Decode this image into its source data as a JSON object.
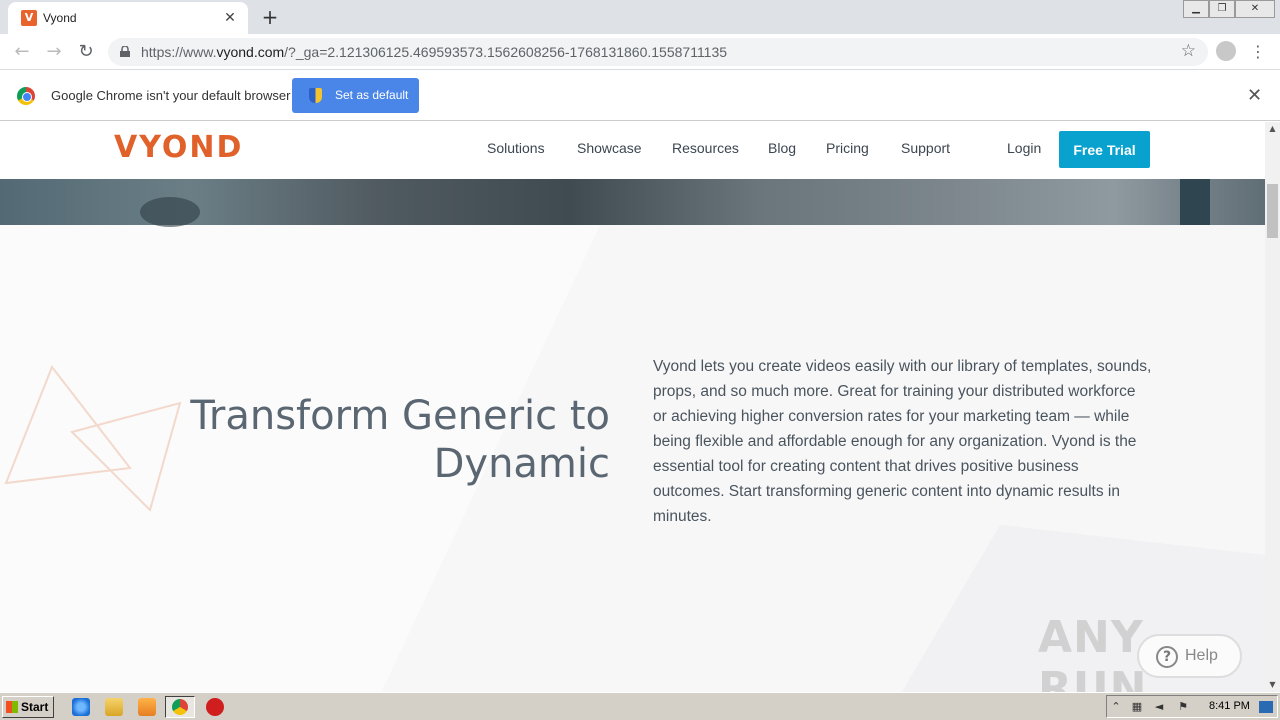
{
  "browser": {
    "tab_title": "Vyond",
    "tab_favicon_letter": "V",
    "new_tab_symbol": "+",
    "tab_close_symbol": "✕",
    "url_prefix": "https://www.",
    "url_domain": "vyond.com",
    "url_path": "/?_ga=2.121306125.469593573.1562608256-1768131860.1558711135",
    "infobar_text": "Google Chrome isn't your default browser",
    "set_default_label": "Set as default",
    "infobar_close": "✕"
  },
  "site": {
    "logo": "VYOND",
    "nav": [
      "Solutions",
      "Showcase",
      "Resources",
      "Blog",
      "Pricing",
      "Support"
    ],
    "login": "Login",
    "cta": "Free Trial",
    "brand_color": "#e0612a",
    "cta_color": "#09a2cf"
  },
  "hero": {
    "headline_line1": "Transform Generic to",
    "headline_line2": "Dynamic",
    "body": "Vyond lets you create videos easily with our library of templates, sounds, props, and so much more. Great for training your distributed workforce or achieving higher conversion rates for your marketing team — while being flexible and affordable enough for any organization. Vyond is the essential tool for creating content that drives positive business outcomes. Start transforming generic content into dynamic results in minutes."
  },
  "overlay": {
    "watermark": "ANY RUN",
    "help_label": "Help",
    "help_icon": "?"
  },
  "taskbar": {
    "start_label": "Start",
    "clock": "8:41 PM"
  }
}
